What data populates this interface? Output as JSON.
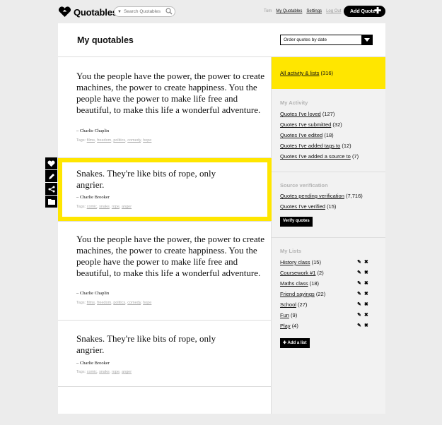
{
  "app": {
    "name": "Quotables"
  },
  "search": {
    "placeholder": "Search Quotables"
  },
  "usernav": {
    "user": "Tom",
    "my_quotables": "My Quotables",
    "settings": "Settings",
    "logout": "Log Out"
  },
  "add_quote": "Add Quote",
  "page": {
    "title": "My quotables",
    "order_label": "Order quotes by date"
  },
  "quotes": [
    {
      "text": "You the people have the power, the power to create machines, the power to create happiness. You the people have the power to make life free and beautiful, to make this life a wonderful adventure.",
      "author": "– Charlie Chaplin",
      "tags_label": "Tags:",
      "tags": [
        "films",
        "freedom",
        "politics",
        "comedy",
        "hope"
      ]
    },
    {
      "text": "Snakes. They're like bits of rope, only angrier.",
      "author": "– Charlie Brooker",
      "tags_label": "Tags:",
      "tags": [
        "comic",
        "snake",
        "rope",
        "anger"
      ]
    },
    {
      "text": "You the people have the power, the power to create machines, the power to create happiness. You the people have the power to make life free and beautiful, to make this life a wonderful adventure.",
      "author": "– Charlie Chaplin",
      "tags_label": "Tags:",
      "tags": [
        "films",
        "freedom",
        "politics",
        "comedy",
        "hope"
      ]
    },
    {
      "text": "Snakes. They're like bits of rope, only angrier.",
      "author": "– Charlie Brooker",
      "tags_label": "Tags:",
      "tags": [
        "comic",
        "snake",
        "rope",
        "anger"
      ]
    }
  ],
  "toolbar": {
    "icons": [
      "heart-icon",
      "pencil-icon",
      "share-icon",
      "folder-icon"
    ]
  },
  "sidebar": {
    "all_activity": {
      "label": "All activity & lists",
      "count": "(316)"
    },
    "my_activity": {
      "heading": "My Activity",
      "items": [
        {
          "label": "Quotes I've loved",
          "count": "(127)"
        },
        {
          "label": "Quotes I've submitted",
          "count": "(32)"
        },
        {
          "label": "Quotes I've edited",
          "count": "(18)"
        },
        {
          "label": "Quotes I've added tags to",
          "count": "(12)"
        },
        {
          "label": "Quotes I've added a source to",
          "count": "(7)"
        }
      ]
    },
    "source_verification": {
      "heading": "Source verification",
      "items": [
        {
          "label": "Quotes pending verification",
          "count": "(7,716)"
        },
        {
          "label": "Quotes I've verified",
          "count": "(15)"
        }
      ],
      "button": "Verify quotes"
    },
    "my_lists": {
      "heading": "My Lists",
      "items": [
        {
          "label": "History class",
          "count": "(15)"
        },
        {
          "label": "Coursework #1",
          "count": "(2)"
        },
        {
          "label": "Maths class",
          "count": "(18)"
        },
        {
          "label": "Friend sayings",
          "count": "(22)"
        },
        {
          "label": "School",
          "count": "(27)"
        },
        {
          "label": "Fun",
          "count": "(9)"
        },
        {
          "label": "Play",
          "count": "(4)"
        }
      ],
      "button": "Add a list"
    }
  },
  "colors": {
    "accent": "#ffe600",
    "black": "#000000",
    "muted": "#b3b3b3"
  }
}
